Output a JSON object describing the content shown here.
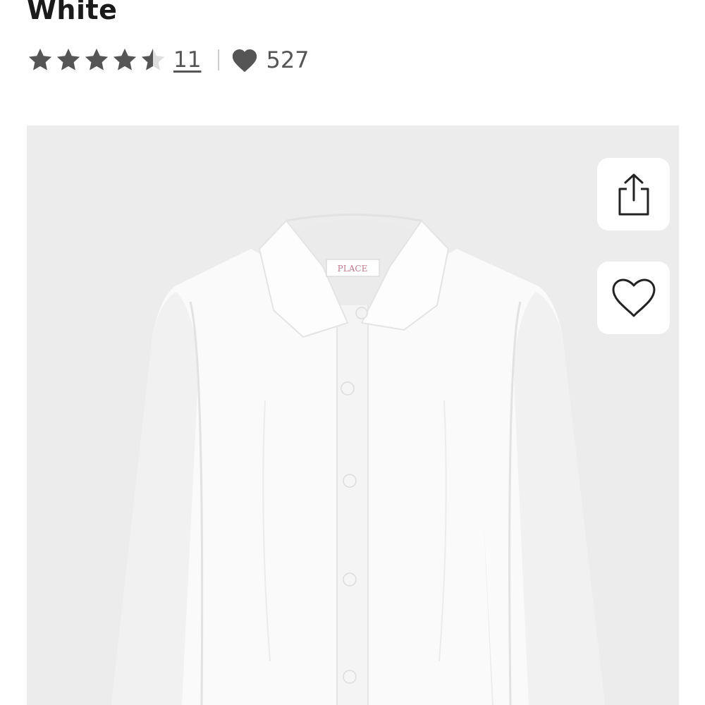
{
  "product": {
    "title": "White",
    "rating": 4.5,
    "rating_max": 5,
    "review_count": "11",
    "favorites_count": "527",
    "image_label": "PLACE"
  },
  "colors": {
    "star_filled": "#555555",
    "star_empty": "#dddddd",
    "image_bg": "#ececec"
  },
  "icons": {
    "share": "share-icon",
    "wishlist": "heart-outline-icon",
    "favorites": "heart-filled-icon"
  }
}
